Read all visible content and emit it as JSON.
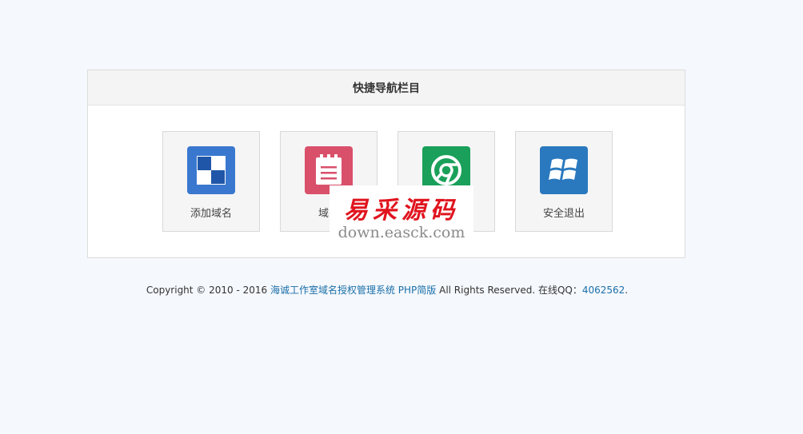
{
  "panel": {
    "title": "快捷导航栏目"
  },
  "tiles": [
    {
      "label": "添加域名",
      "icon": "grid-icon",
      "color": "#3a78cf"
    },
    {
      "label": "域名",
      "icon": "notepad-icon",
      "color": "#d9506b"
    },
    {
      "label": "",
      "icon": "chrome-icon",
      "color": "#1aa05a"
    },
    {
      "label": "安全退出",
      "icon": "windows-icon",
      "color": "#2a79bf"
    }
  ],
  "watermark": {
    "cn": "易采源码",
    "en": "down.easck.com"
  },
  "footer": {
    "prefix": "Copyright © 2010 - 2016 ",
    "system_link": "海诚工作室域名授权管理系统 PHP简版",
    "middle": " All Rights Reserved.  在线QQ：",
    "qq_link": "4062562",
    "suffix": "."
  }
}
